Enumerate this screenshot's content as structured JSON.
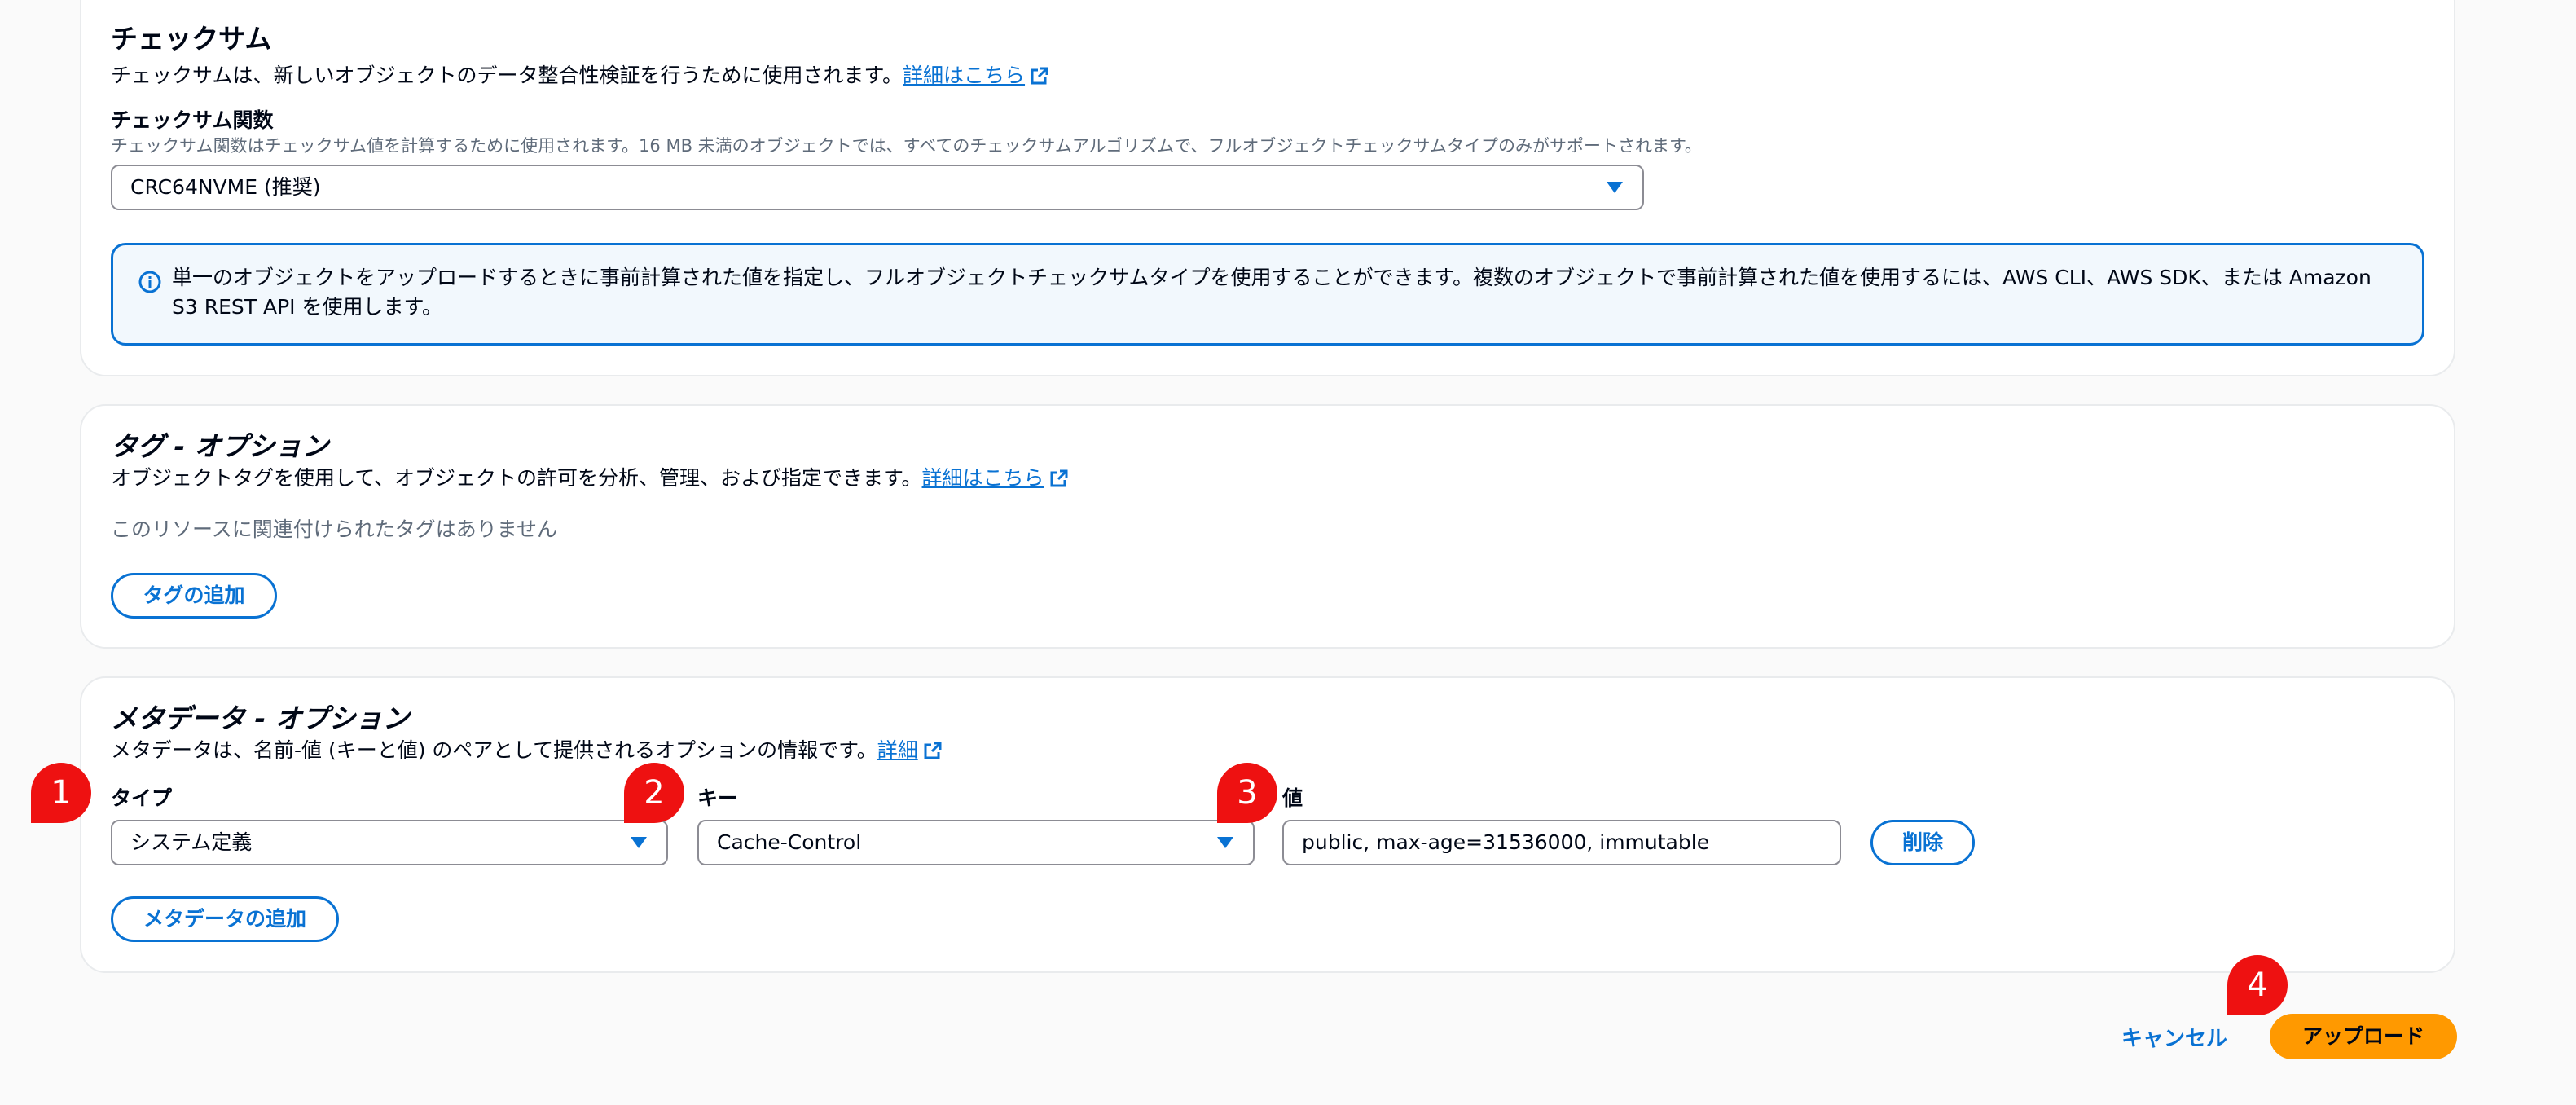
{
  "checksum": {
    "title": "チェックサム",
    "description": "チェックサムは、新しいオブジェクトのデータ整合性検証を行うために使用されます。",
    "learn_more": "詳細はこちら",
    "function_label": "チェックサム関数",
    "function_hint": "チェックサム関数はチェックサム値を計算するために使用されます。16 MB 未満のオブジェクトでは、すべてのチェックサムアルゴリズムで、フルオブジェクトチェックサムタイプのみがサポートされます。",
    "function_value": "CRC64NVME (推奨)",
    "info_text": "単一のオブジェクトをアップロードするときに事前計算された値を指定し、フルオブジェクトチェックサムタイプを使用することができます。複数のオブジェクトで事前計算された値を使用するには、AWS CLI、AWS SDK、または Amazon S3 REST API を使用します。"
  },
  "tags": {
    "title": "タグ - オプション",
    "description": "オブジェクトタグを使用して、オブジェクトの許可を分析、管理、および指定できます。",
    "learn_more": "詳細はこちら",
    "empty_text": "このリソースに関連付けられたタグはありません",
    "add_button": "タグの追加"
  },
  "metadata": {
    "title": "メタデータ - オプション",
    "description": "メタデータは、名前-値 (キーと値) のペアとして提供されるオプションの情報です。",
    "learn_more": "詳細",
    "type_label": "タイプ",
    "type_value": "システム定義",
    "key_label": "キー",
    "key_value": "Cache-Control",
    "value_label": "値",
    "value_value": "public, max-age=31536000, immutable",
    "remove_button": "削除",
    "add_button": "メタデータの追加"
  },
  "footer": {
    "cancel": "キャンセル",
    "upload": "アップロード"
  },
  "badges": [
    "1",
    "2",
    "3",
    "4"
  ],
  "colors": {
    "link": "#0972d3",
    "primary": "#ff9900",
    "badge": "#ee1111",
    "info_bg": "#f2f8fd"
  }
}
